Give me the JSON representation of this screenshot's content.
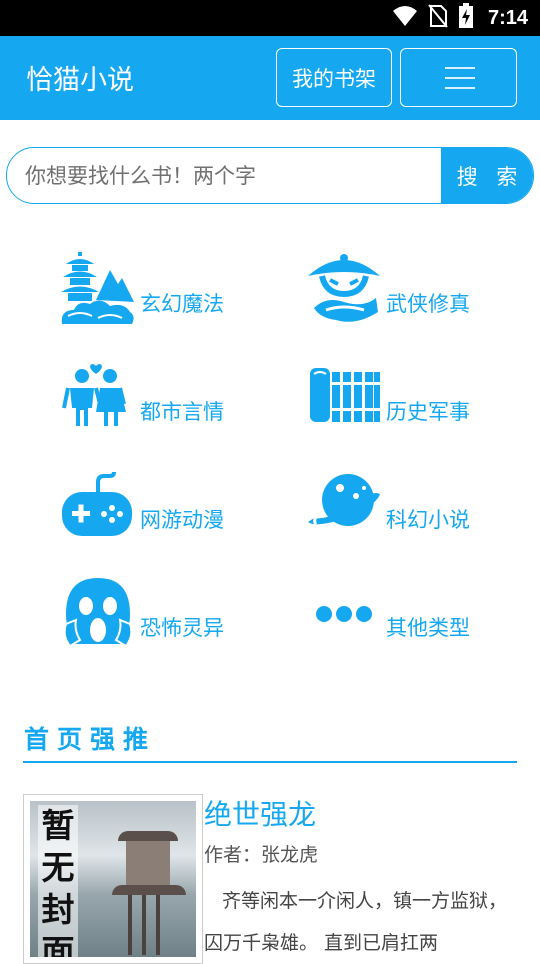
{
  "status_bar": {
    "time": "7:14",
    "icons": [
      "wifi-icon",
      "no-sim-icon",
      "battery-charging-icon"
    ]
  },
  "header": {
    "title": "恰猫小说",
    "bookshelf_label": "我的书架",
    "menu_icon": "hamburger-menu-icon"
  },
  "search": {
    "placeholder": "你想要找什么书！两个字",
    "value": "",
    "button_label": "搜 索"
  },
  "categories": [
    {
      "label": "玄幻魔法",
      "icon": "pagoda-mountain-icon"
    },
    {
      "label": "武侠修真",
      "icon": "swordsman-hat-icon"
    },
    {
      "label": "都市言情",
      "icon": "couple-icon"
    },
    {
      "label": "历史军事",
      "icon": "bamboo-scroll-icon"
    },
    {
      "label": "网游动漫",
      "icon": "gamepad-icon"
    },
    {
      "label": "科幻小说",
      "icon": "planet-icon"
    },
    {
      "label": "恐怖灵异",
      "icon": "scream-face-icon"
    },
    {
      "label": "其他类型",
      "icon": "more-dots-icon"
    }
  ],
  "featured": {
    "section_title": "首页强推",
    "book": {
      "cover_text": "暂无封面",
      "title": "绝世强龙",
      "author": "作者：张龙虎",
      "description": "齐等闲本一介闲人，镇一方监狱，囚万千枭雄。 直到已肩扛两"
    }
  },
  "colors": {
    "accent": "#15a8f0",
    "status_bar": "#000000",
    "background": "#ffffff"
  }
}
